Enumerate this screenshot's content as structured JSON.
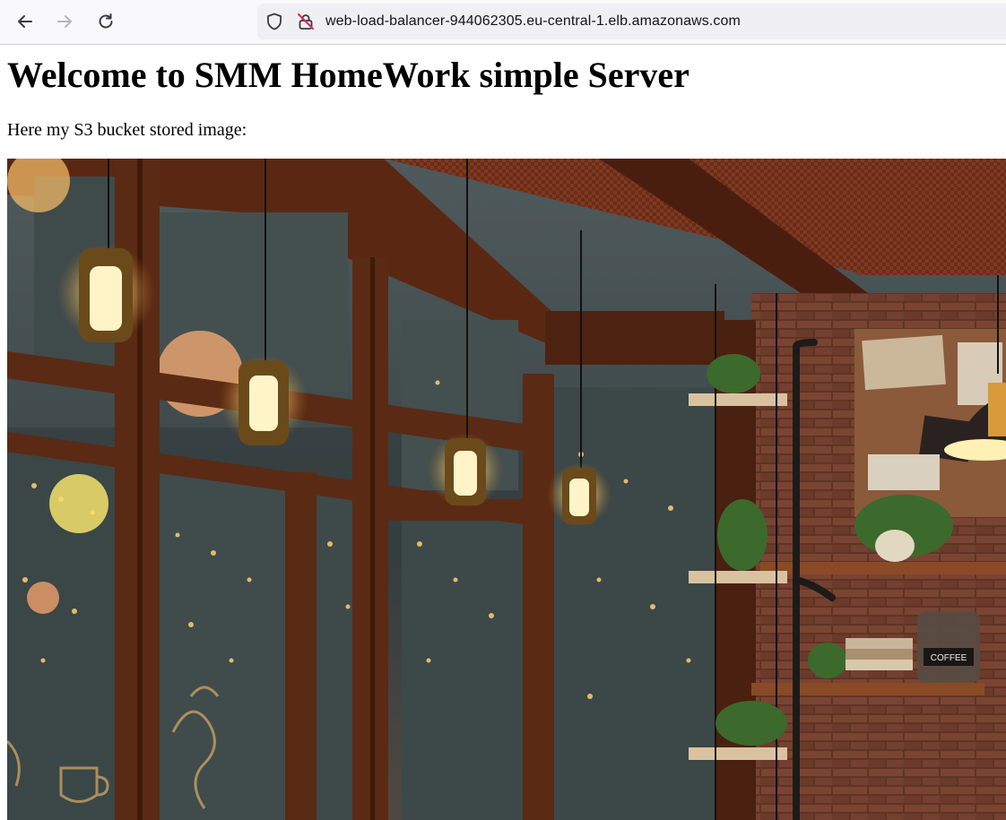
{
  "browser": {
    "url": "web-load-balancer-944062305.eu-central-1.elb.amazonaws.com",
    "icons": [
      "back-arrow-icon",
      "forward-arrow-icon",
      "reload-icon",
      "tracking-shield-icon",
      "insecure-lock-icon"
    ]
  },
  "page": {
    "title": "Welcome to SMM HomeWork simple Server",
    "intro": "Here my S3 bucket stored image:"
  },
  "image": {
    "subject": "cafe-interior-photo",
    "sign_text": "COFFEE"
  },
  "colors": {
    "toolbar_bg": "#f9f9fb",
    "urlbar_bg": "#f0f0f4",
    "lamp_glow": "#fff3c4",
    "wood": "#5a2a14"
  }
}
